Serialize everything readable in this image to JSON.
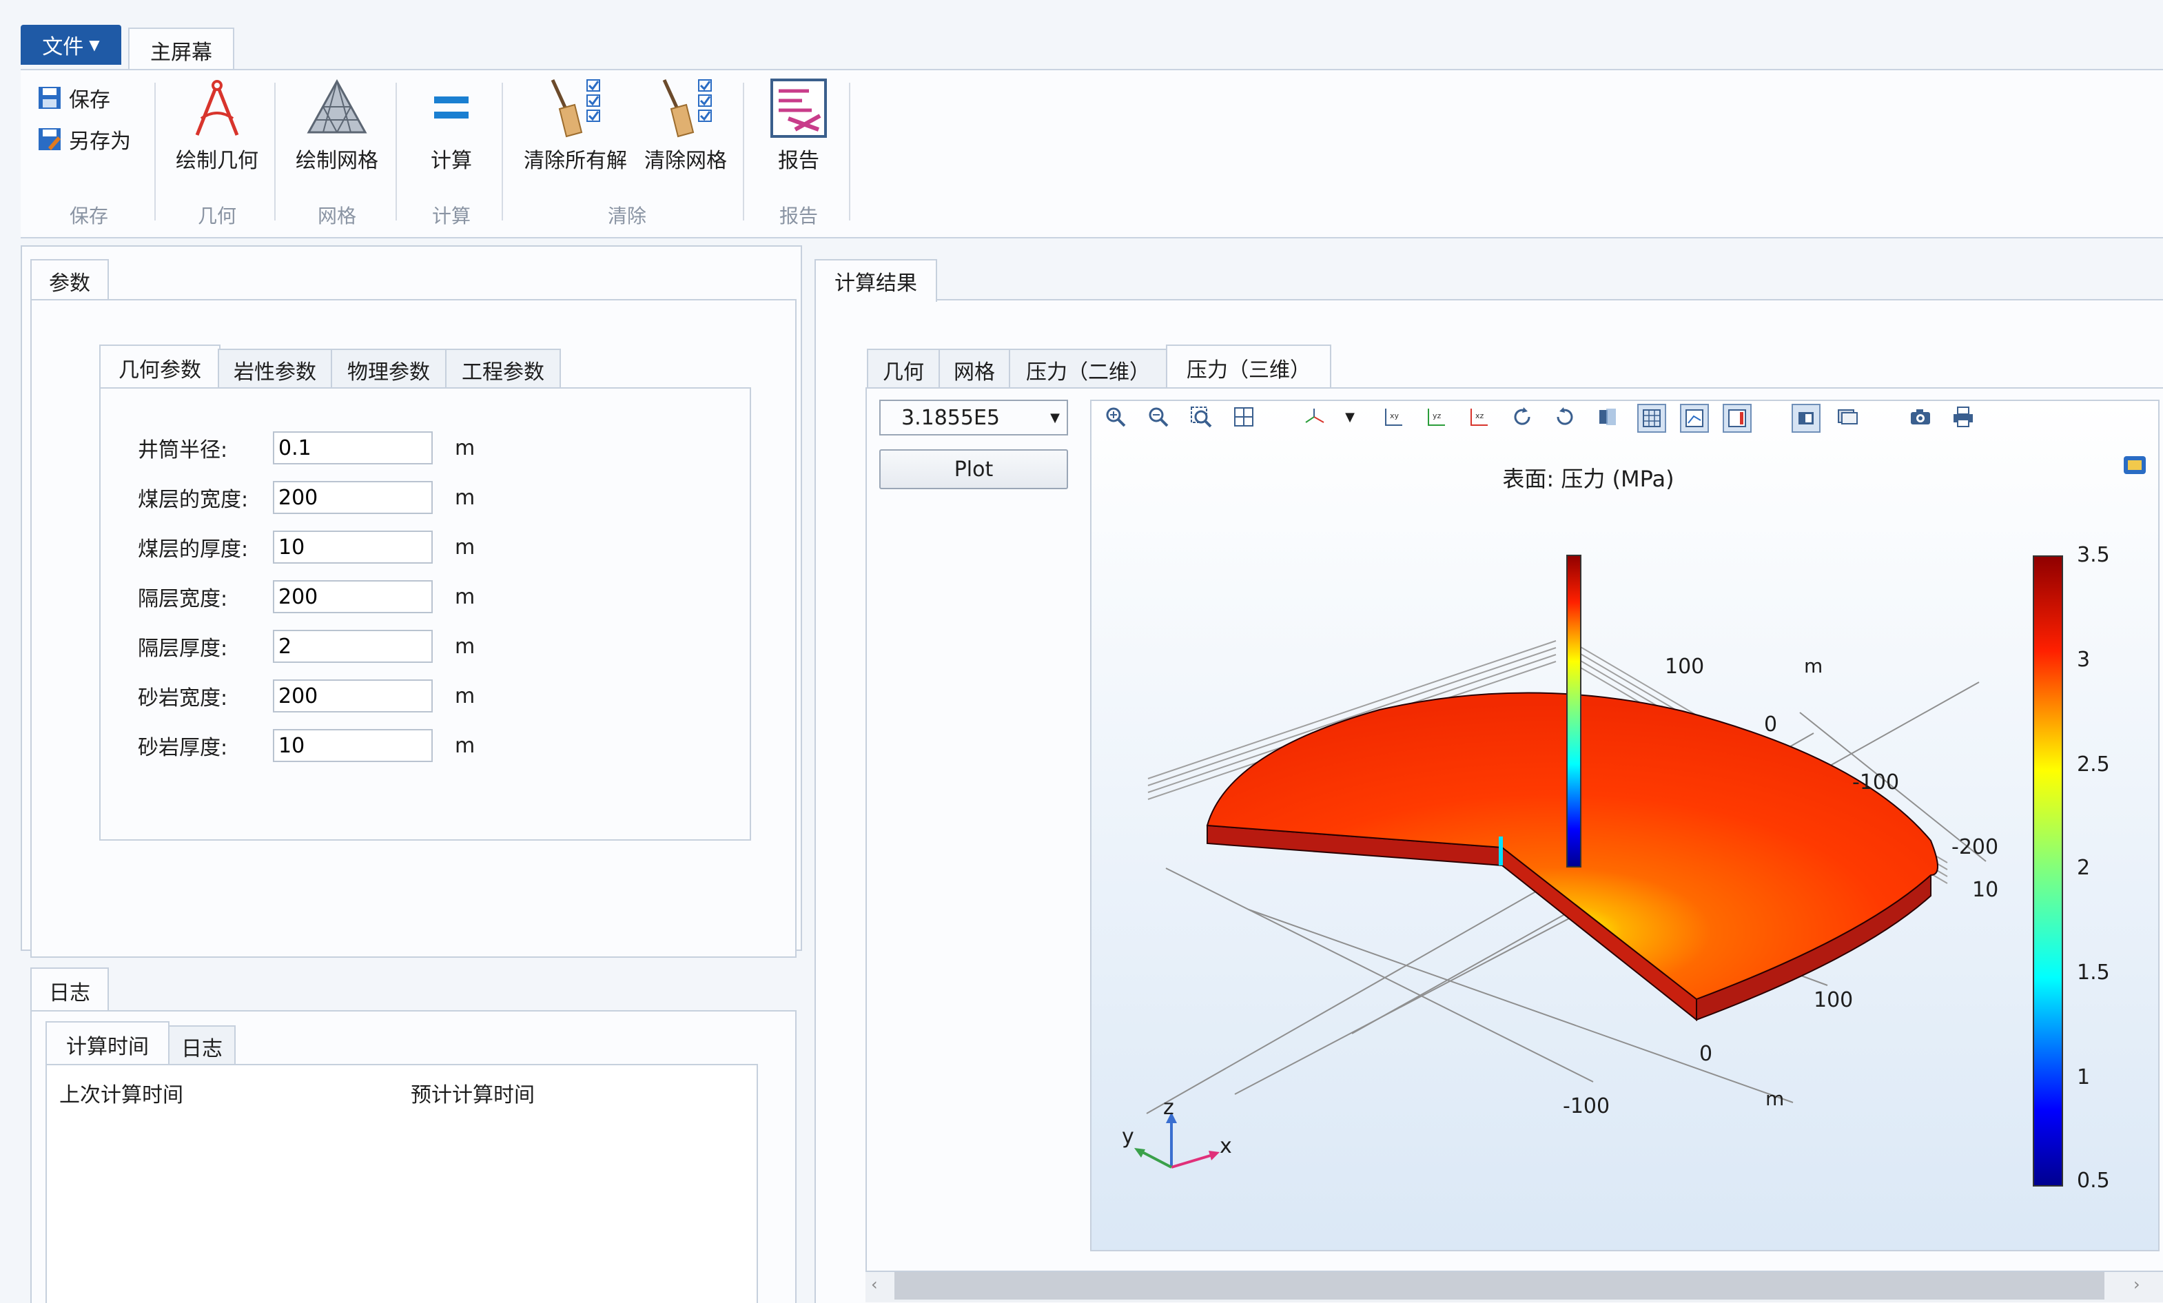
{
  "menu": {
    "file": "文件",
    "home_tab": "主屏幕"
  },
  "ribbon": {
    "save": "保存",
    "save_as": "另存为",
    "draw_geometry": "绘制几何",
    "draw_mesh": "绘制网格",
    "compute": "计算",
    "clear_solutions": "清除所有解",
    "clear_mesh": "清除网格",
    "report": "报告",
    "groups": [
      "保存",
      "几何",
      "网格",
      "计算",
      "清除",
      "报告"
    ]
  },
  "params_panel": {
    "tab": "参数",
    "subtabs": [
      "几何参数",
      "岩性参数",
      "物理参数",
      "工程参数"
    ],
    "rows": [
      {
        "label": "井筒半径:",
        "value": "0.1",
        "unit": "m"
      },
      {
        "label": "煤层的宽度:",
        "value": "200",
        "unit": "m"
      },
      {
        "label": "煤层的厚度:",
        "value": "10",
        "unit": "m"
      },
      {
        "label": "隔层宽度:",
        "value": "200",
        "unit": "m"
      },
      {
        "label": "隔层厚度:",
        "value": "2",
        "unit": "m"
      },
      {
        "label": "砂岩宽度:",
        "value": "200",
        "unit": "m"
      },
      {
        "label": "砂岩厚度:",
        "value": "10",
        "unit": "m"
      }
    ]
  },
  "log_panel": {
    "tab": "日志",
    "subtabs": [
      "计算时间",
      "日志"
    ],
    "col_last": "上次计算时间",
    "col_estimated": "预计计算时间"
  },
  "results_panel": {
    "tab": "计算结果",
    "subtabs": [
      "几何",
      "网格",
      "压力（二维）",
      "压力（三维）"
    ],
    "time_select": "3.1855E5",
    "plot_button": "Plot",
    "plot_title": "表面: 压力 (MPa)",
    "colorbar_ticks": [
      "3.5",
      "3",
      "2.5",
      "2",
      "1.5",
      "1",
      "0.5"
    ],
    "axis_labels": {
      "y_ticks": [
        "100",
        "0",
        "-100",
        "-200"
      ],
      "z_tick": "10",
      "x_ticks": [
        "100",
        "0",
        "-100"
      ],
      "unit": "m"
    },
    "triad": {
      "x": "x",
      "y": "y",
      "z": "z"
    }
  },
  "colors": {
    "accent": "#1f5aa6",
    "panel_border": "#c6d0dd"
  }
}
